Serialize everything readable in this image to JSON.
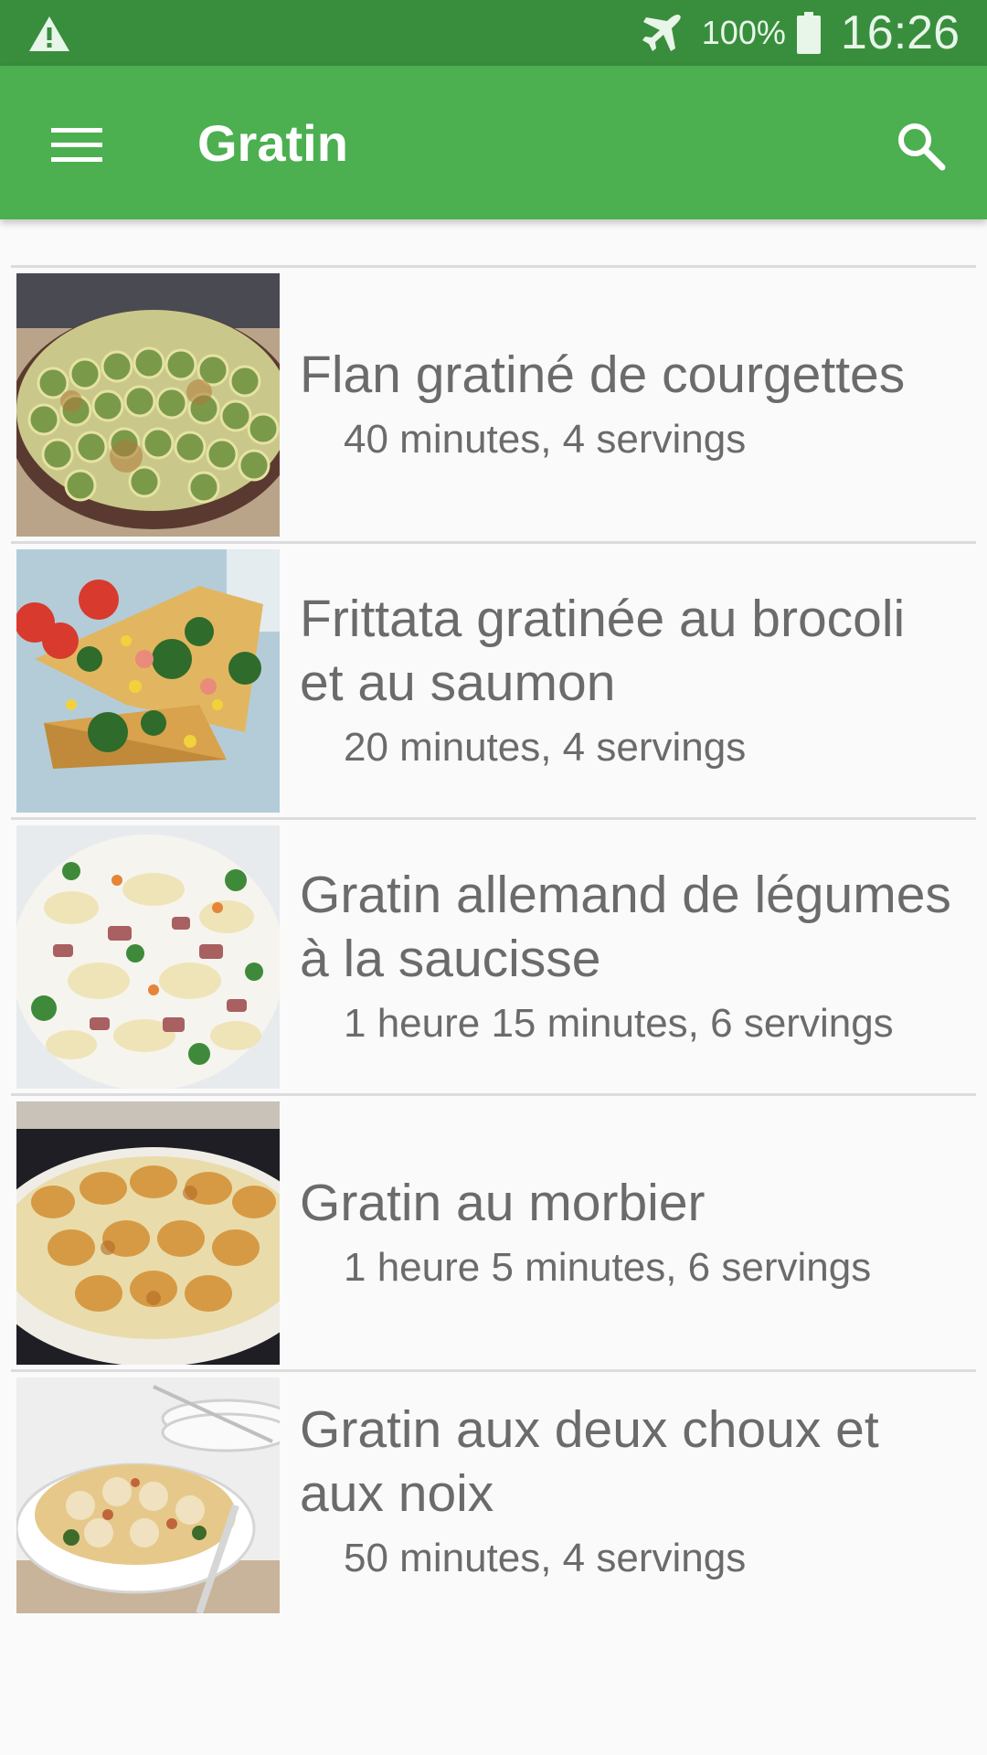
{
  "status_bar": {
    "battery_percent": "100%",
    "time": "16:26",
    "icons": [
      "warning-icon",
      "airplane-mode-icon",
      "battery-icon"
    ]
  },
  "app_bar": {
    "title": "Gratin",
    "icons": [
      "menu-icon",
      "search-icon"
    ]
  },
  "colors": {
    "status_bar": "#388e3c",
    "app_bar": "#4caf50",
    "text": "#6b6b6b",
    "divider": "#dcdcdc"
  },
  "recipes": [
    {
      "name": "Flan gratiné de courgettes",
      "meta": "40 minutes, 4 servings"
    },
    {
      "name": "Frittata gratinée au brocoli et au saumon",
      "meta": "20 minutes, 4 servings"
    },
    {
      "name": "Gratin allemand de légumes à la saucisse",
      "meta": "1 heure 15 minutes, 6 servings"
    },
    {
      "name": "Gratin au morbier",
      "meta": "1 heure 5 minutes, 6 servings"
    },
    {
      "name": "Gratin aux deux choux et aux noix",
      "meta": "50 minutes, 4 servings"
    }
  ]
}
